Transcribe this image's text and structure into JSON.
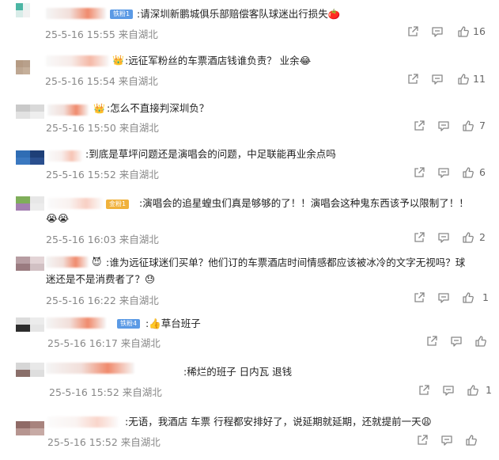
{
  "comments": [
    {
      "text": ":请深圳新鹏城俱乐部赔偿客队球迷出行损失🍅",
      "badge": "铁粉1",
      "date": "25-5-16 15:55",
      "location": "来自湖北",
      "likes": "16"
    },
    {
      "text": ":远征军粉丝的车票酒店钱谁负责？  业余😂",
      "date": "25-5-16 15:54",
      "location": "来自湖北",
      "likes": "11"
    },
    {
      "text": ":怎么不直接判深圳负？",
      "date": "25-5-16 15:50",
      "location": "来自湖北",
      "likes": "7"
    },
    {
      "text": ":到底是草坪问题还是演唱会的问题，中足联能再业余点吗",
      "date": "25-5-16 15:52",
      "location": "来自湖北",
      "likes": "6"
    },
    {
      "text_line1": ":演唱会的追星蝗虫们真是够够的了！！演唱会这种鬼东西该予以限制了！！",
      "text_line2": "😭😭",
      "badge": "金粉1",
      "date": "25-5-16 16:03",
      "location": "来自湖北",
      "likes": "2"
    },
    {
      "text_line1": ":谁为远征球迷们买单？他们订的车票酒店时间情感都应该被冰冷的文字无视吗？球",
      "text_line2": "迷还是不是消费者了？😓",
      "date": "25-5-16 16:22",
      "location": "来自湖北",
      "likes": "1"
    },
    {
      "text": ":👍草台班子",
      "badge": "铁粉4",
      "date": "25-5-16 16:17",
      "location": "来自湖北",
      "likes": ""
    },
    {
      "text": ":稀烂的班子 日内瓦 退钱",
      "date": "25-5-16 15:52",
      "location": "来自湖北",
      "likes": "1"
    },
    {
      "text": ":无语，我酒店 车票 行程都安排好了，说延期就延期，还就提前一天😩",
      "date": "25-5-16 15:52",
      "location": "来自湖北",
      "likes": ""
    }
  ],
  "colors": {
    "meta_gray": "#888888",
    "badge_blue": "#5b9ae5",
    "badge_gold": "#f0b13b"
  },
  "icons": [
    "share-icon",
    "comment-icon",
    "like-icon",
    "crown-icon"
  ]
}
